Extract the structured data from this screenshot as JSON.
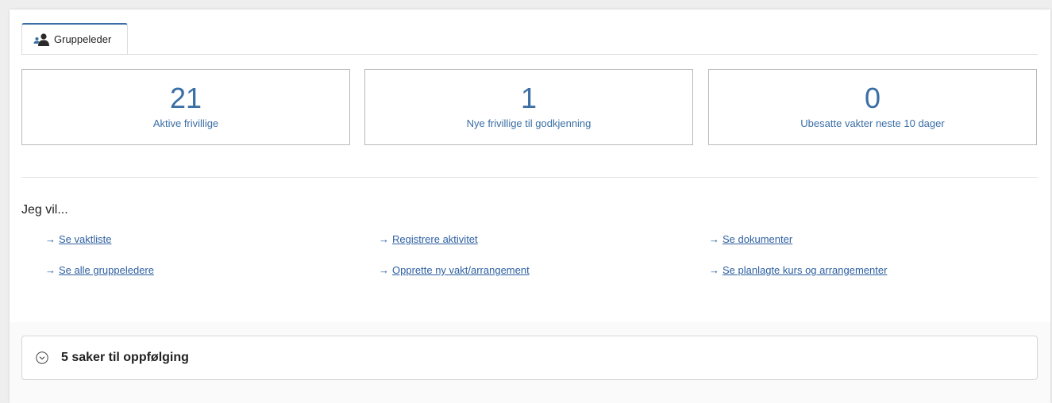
{
  "tab": {
    "label": "Gruppeleder",
    "icon": "group-leader-icon"
  },
  "stats": [
    {
      "value": "21",
      "label": "Aktive frivillige"
    },
    {
      "value": "1",
      "label": "Nye frivillige til godkjenning"
    },
    {
      "value": "0",
      "label": "Ubesatte vakter neste 10 dager"
    }
  ],
  "actions": {
    "heading": "Jeg vil...",
    "arrow": "→",
    "links": [
      "Se vaktliste",
      "Registrere aktivitet",
      "Se dokumenter",
      "Se alle gruppeledere",
      "Opprette ny vakt/arrangement",
      "Se planlagte kurs og arrangementer"
    ]
  },
  "followup": {
    "label": "5 saker til oppfølging",
    "icon": "chevron-down-circle-icon"
  },
  "colors": {
    "accent": "#3a6ea5",
    "link": "#2d5fa0",
    "border": "#b9b9b9"
  }
}
